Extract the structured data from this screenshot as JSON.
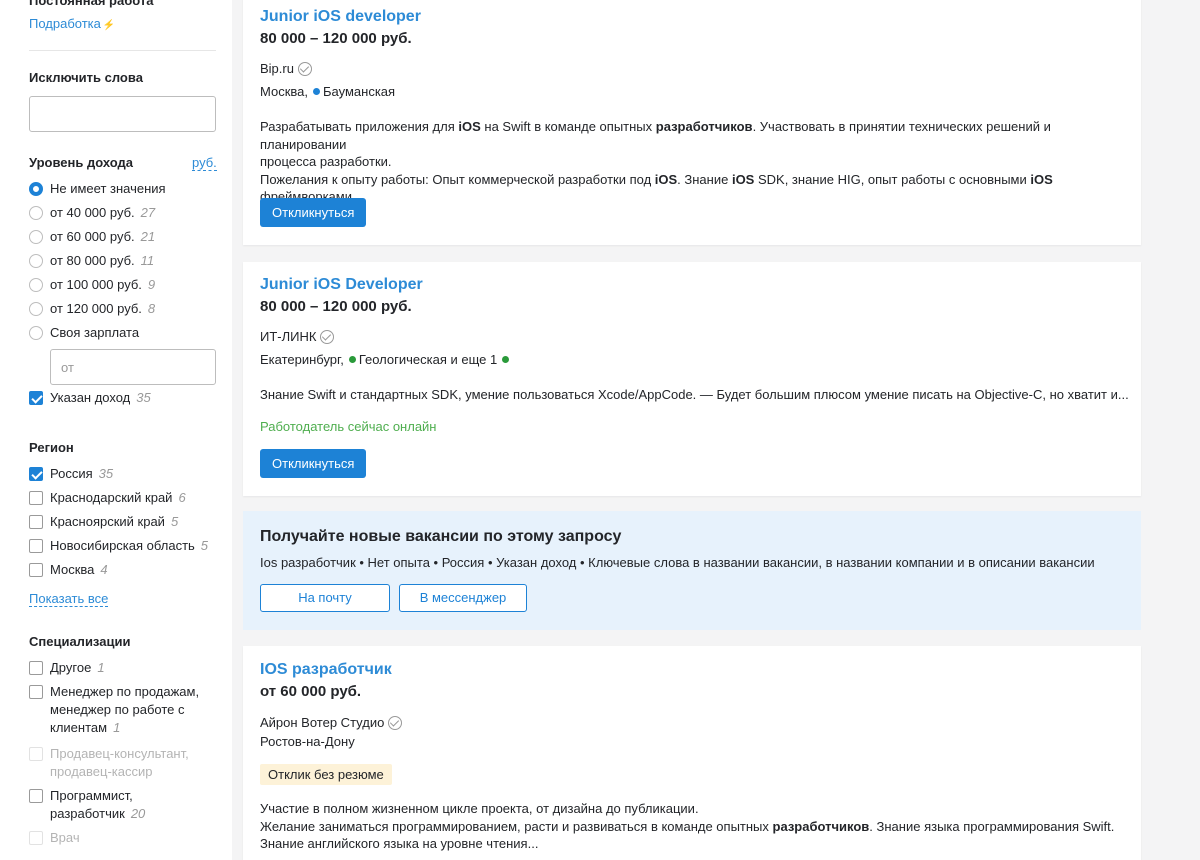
{
  "sidebar": {
    "cut_heading": "Постоянная работа",
    "side_job_link": "Подработка",
    "exclude_words": {
      "title": "Исключить слова",
      "value": ""
    },
    "income": {
      "title": "Уровень дохода",
      "currency_link": "руб.",
      "options": [
        {
          "label": "Не имеет значения",
          "count": "",
          "selected": true
        },
        {
          "label": "от 40 000 руб.",
          "count": "27"
        },
        {
          "label": "от 60 000 руб.",
          "count": "21"
        },
        {
          "label": "от 80 000 руб.",
          "count": "11"
        },
        {
          "label": "от 100 000 руб.",
          "count": "9"
        },
        {
          "label": "от 120 000 руб.",
          "count": "8"
        },
        {
          "label": "Своя зарплата",
          "count": ""
        }
      ],
      "custom_placeholder": "от",
      "specified_income": {
        "label": "Указан доход",
        "count": "35",
        "checked": true
      }
    },
    "region": {
      "title": "Регион",
      "items": [
        {
          "label": "Россия",
          "count": "35",
          "checked": true
        },
        {
          "label": "Краснодарский край",
          "count": "6"
        },
        {
          "label": "Красноярский край",
          "count": "5"
        },
        {
          "label": "Новосибирская область",
          "count": "5"
        },
        {
          "label": "Москва",
          "count": "4"
        }
      ],
      "show_all": "Показать все"
    },
    "specializations": {
      "title": "Специализации",
      "items": [
        {
          "label": "Другое",
          "count": "1"
        },
        {
          "label_line1": "Менеджер по продажам,",
          "label_line2": "менеджер по работе с",
          "label_line3": "клиентам",
          "count": "1"
        },
        {
          "label_line1": "Продавец-консультант,",
          "label_line2": "продавец-кассир",
          "disabled": true
        },
        {
          "label_line1": "Программист,",
          "label_line2": "разработчик",
          "count": "20"
        },
        {
          "label": "Врач",
          "disabled": true
        }
      ]
    }
  },
  "vacancies": [
    {
      "title": "Junior iOS developer",
      "salary": "80 000 – 120 000 руб.",
      "company": "Bip.ru",
      "city": "Москва,",
      "metro": "Бауманская",
      "metro_color": "#1d82d6",
      "desc_line1_a": "Разрабатывать приложения для ",
      "desc_line1_b": "iOS",
      "desc_line1_c": " на Swift в команде опытных ",
      "desc_line1_d": "разработчиков",
      "desc_line1_e": ". Участвовать в принятии технических решений и планировании",
      "desc_line2": "процесса разработки.",
      "desc_line3_a": "Пожелания к опыту работы: Опыт коммерческой разработки под ",
      "desc_line3_b": "iOS",
      "desc_line3_c": ". Знание ",
      "desc_line3_d": "iOS",
      "desc_line3_e": " SDK, знание HIG, опыт работы с основными ",
      "desc_line3_f": "iOS",
      "desc_line3_g": " фреймворками.",
      "respond": "Откликнуться"
    },
    {
      "title": "Junior iOS Developer",
      "salary": "80 000 – 120 000 руб.",
      "company": "ИТ-ЛИНК",
      "city": "Екатеринбург,",
      "metro": "Геологическая и еще 1",
      "metro_color": "#2a9a3a",
      "desc": "Знание Swift и стандартных SDK, умение пользоваться Xcode/AppCode. — Будет большим плюсом умение писать на Objective-C, но хватит и...",
      "online": "Работодатель сейчас онлайн",
      "respond": "Откликнуться"
    },
    {
      "title": "IOS разработчик",
      "salary": "от 60 000 руб.",
      "company": "Айрон Вотер Студио",
      "city": "Ростов-на-Дону",
      "badge": "Отклик без резюме",
      "desc_line1": "Участие в полном жизненном цикле проекта, от дизайна до публикации.",
      "desc_line2_a": "Желание заниматься программированием, расти и развиваться в команде опытных ",
      "desc_line2_b": "разработчиков",
      "desc_line2_c": ". Знание языка программирования Swift.",
      "desc_line3": "Знание английского языка на уровне чтения..."
    }
  ],
  "subscribe": {
    "title": "Получайте новые вакансии по этому запросу",
    "query": "Ios разработчик • Нет опыта • Россия • Указан доход • Ключевые слова в названии вакансии, в названии компании и в описании вакансии",
    "email_button": "На почту",
    "messenger_button": "В мессенджер"
  },
  "colors": {
    "accent": "#1d82d6",
    "link": "#2d8bd6",
    "online": "#4fae4f",
    "subscribe_bg": "#e7f2fc",
    "badge_bg": "#fdf2d8"
  }
}
